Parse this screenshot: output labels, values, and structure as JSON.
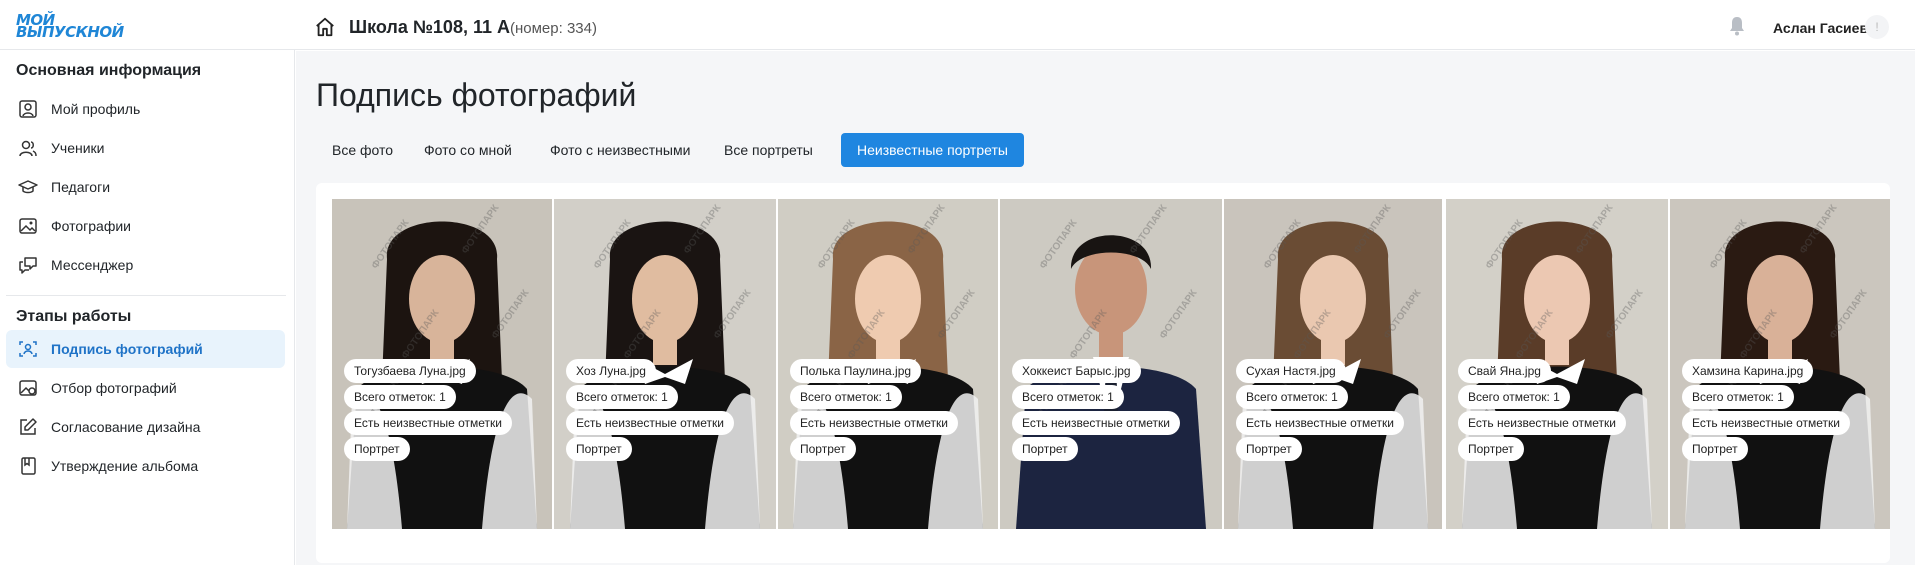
{
  "header": {
    "logo_line1": "МОЙ",
    "logo_line2": "ВЫПУСКНОЙ",
    "school_title": "Школа №108, 11 А",
    "school_number": "(номер: 334)",
    "user_name": "Аслан Гасиев",
    "user_initial": "!"
  },
  "sidebar": {
    "section1_title": "Основная информация",
    "section1_items": [
      {
        "label": "Мой профиль",
        "icon": "profile-icon"
      },
      {
        "label": "Ученики",
        "icon": "users-icon"
      },
      {
        "label": "Педагоги",
        "icon": "graduation-cap-icon"
      },
      {
        "label": "Фотографии",
        "icon": "image-icon"
      },
      {
        "label": "Мессенджер",
        "icon": "chat-icon"
      }
    ],
    "section2_title": "Этапы работы",
    "section2_items": [
      {
        "label": "Подпись фотографий",
        "icon": "face-scan-icon",
        "active": true
      },
      {
        "label": "Отбор фотографий",
        "icon": "image-select-icon"
      },
      {
        "label": "Согласование дизайна",
        "icon": "edit-icon"
      },
      {
        "label": "Утверждение альбома",
        "icon": "book-icon"
      }
    ]
  },
  "main": {
    "title": "Подпись фотографий",
    "tabs": [
      {
        "label": "Все фото"
      },
      {
        "label": "Фото со мной"
      },
      {
        "label": "Фото с неизвестными"
      },
      {
        "label": "Все портреты"
      },
      {
        "label": "Неизвестные портреты",
        "active": true
      }
    ],
    "photos": [
      {
        "filename": "Тогузбаева Луна.jpg",
        "marks": "Всего отметок: 1",
        "status": "Есть неизвестные отметки",
        "type": "Портрет"
      },
      {
        "filename": "Хоз Луна.jpg",
        "marks": "Всего отметок: 1",
        "status": "Есть неизвестные отметки",
        "type": "Портрет"
      },
      {
        "filename": "Полька Паулина.jpg",
        "marks": "Всего отметок: 1",
        "status": "Есть неизвестные отметки",
        "type": "Портрет"
      },
      {
        "filename": "Хоккеист Барыс.jpg",
        "marks": "Всего отметок: 1",
        "status": "Есть неизвестные отметки",
        "type": "Портрет"
      },
      {
        "filename": "Сухая Настя.jpg",
        "marks": "Всего отметок: 1",
        "status": "Есть неизвестные отметки",
        "type": "Портрет"
      },
      {
        "filename": "Свай Яна.jpg",
        "marks": "Всего отметок: 1",
        "status": "Есть неизвестные отметки",
        "type": "Портрет"
      },
      {
        "filename": "Хамзина Карина.jpg",
        "marks": "Всего отметок: 1",
        "status": "Есть неизвестные отметки",
        "type": "Портрет"
      }
    ],
    "watermark": "ФОТОПАРК"
  },
  "colors": {
    "accent": "#1f86e0",
    "active_bg": "#e8f3fc",
    "active_text": "#1f73c7"
  }
}
